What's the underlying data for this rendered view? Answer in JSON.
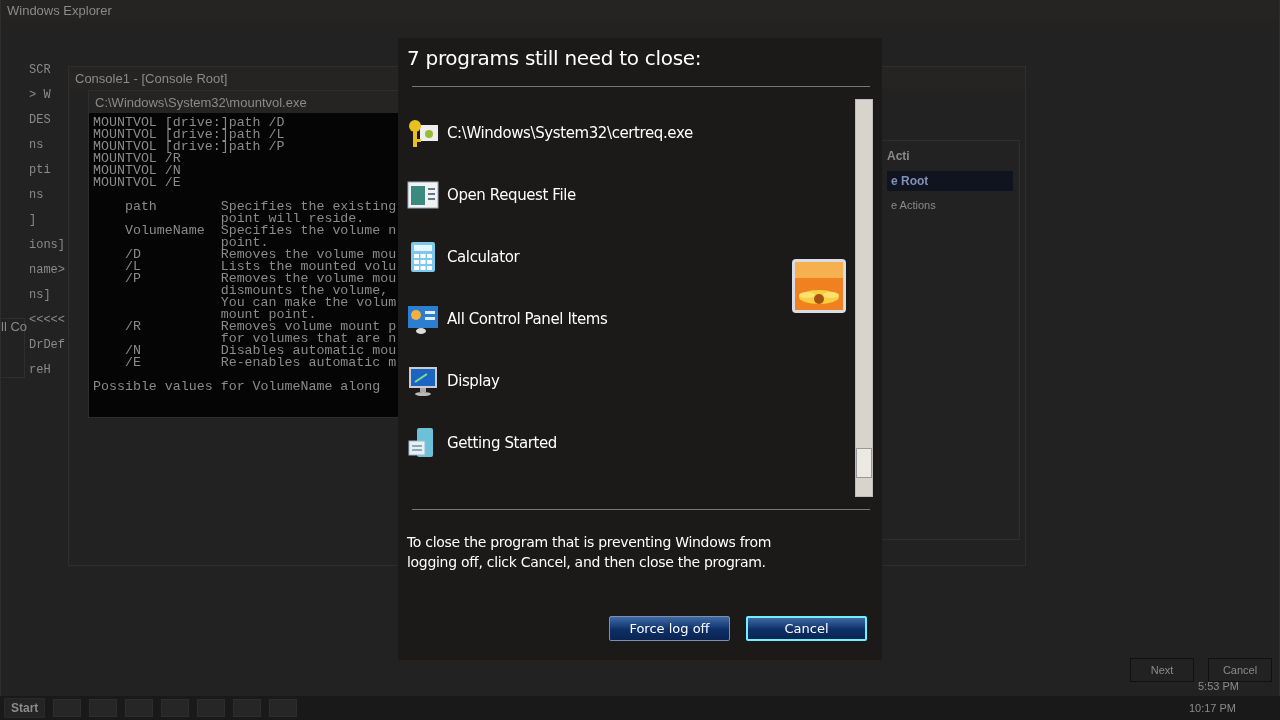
{
  "background": {
    "explorer_title": "Windows Explorer",
    "left_pane_lines": [
      "SCR",
      "> W",
      "DES",
      "ns",
      "pti",
      "ns",
      "]",
      "ions]",
      "name>",
      "ns]",
      "<<<<<",
      "DrDef",
      "reH"
    ],
    "mmc_title": "Console1 - [Console Root]",
    "console": {
      "title": "C:\\Windows\\System32\\mountvol.exe",
      "usage": [
        "MOUNTVOL [drive:]path /D",
        "MOUNTVOL [drive:]path /L",
        "MOUNTVOL [drive:]path /P",
        "MOUNTVOL /R",
        "MOUNTVOL /N",
        "MOUNTVOL /E"
      ],
      "parameters": [
        "    path        Specifies the existing",
        "                point will reside.",
        "    VolumeName  Specifies the volume n",
        "                point.",
        "    /D          Removes the volume mou",
        "    /L          Lists the mounted volu",
        "    /P          Removes the volume mou",
        "                dismounts the volume, ",
        "                You can make the volum",
        "                mount point.",
        "    /R          Removes volume mount p",
        "                for volumes that are n",
        "    /N          Disables automatic mou",
        "    /E          Re-enables automatic m"
      ],
      "footer": [
        "Possible values for VolumeName along "
      ]
    },
    "actions": {
      "header": "Acti",
      "items": [
        "e Root",
        "e Actions"
      ]
    },
    "small_window_title": "ll Co",
    "wizard_buttons": [
      "Next",
      "Cancel"
    ],
    "wizard_time": "5:53 PM"
  },
  "taskbar": {
    "start": "Start",
    "clock": "10:17 PM"
  },
  "dialog": {
    "title": "7 programs still need to close:",
    "programs": [
      {
        "name": "C:\\Windows\\System32\\certreq.exe",
        "kind": "key"
      },
      {
        "name": "Open Request File",
        "kind": "window"
      },
      {
        "name": "Calculator",
        "kind": "calculator"
      },
      {
        "name": "All Control Panel Items",
        "kind": "control"
      },
      {
        "name": "Display",
        "kind": "monitor"
      },
      {
        "name": "Getting Started",
        "kind": "document"
      }
    ],
    "message": "To close the program that is preventing Windows from logging off, click Cancel, and then close the program.",
    "buttons": [
      {
        "label": "Force log off",
        "focused": false
      },
      {
        "label": "Cancel",
        "focused": true
      }
    ]
  }
}
